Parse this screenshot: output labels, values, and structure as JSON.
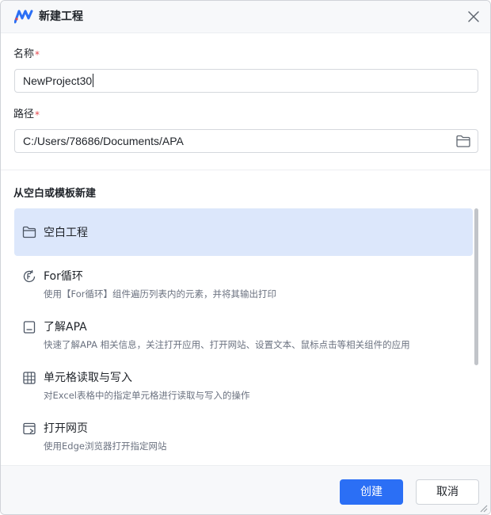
{
  "dialog": {
    "title": "新建工程",
    "logo_icon": "apa-logo-icon",
    "close_icon": "close-icon"
  },
  "form": {
    "name_label": "名称",
    "name_required": "*",
    "name_value": "NewProject30",
    "path_label": "路径",
    "path_required": "*",
    "path_value": "C:/Users/78686/Documents/APA",
    "path_browse_icon": "folder-icon"
  },
  "templates": {
    "section_title": "从空白或模板新建",
    "items": [
      {
        "icon": "folder-outline-icon",
        "title": "空白工程",
        "desc": "",
        "selected": true
      },
      {
        "icon": "for-loop-icon",
        "title": "For循环",
        "desc": "使用【For循环】组件遍历列表内的元素，并将其输出打印",
        "selected": false
      },
      {
        "icon": "document-icon",
        "title": "了解APA",
        "desc": "快速了解APA 相关信息，关注打开应用、打开网站、设置文本、鼠标点击等相关组件的应用",
        "selected": false
      },
      {
        "icon": "table-icon",
        "title": "单元格读取与写入",
        "desc": "对Excel表格中的指定单元格进行读取与写入的操作",
        "selected": false
      },
      {
        "icon": "browser-icon",
        "title": "打开网页",
        "desc": "使用Edge浏览器打开指定网站",
        "selected": false
      }
    ]
  },
  "footer": {
    "create_label": "创建",
    "cancel_label": "取消"
  },
  "colors": {
    "accent": "#2b6ff5",
    "selected_bg": "#dce7fb",
    "required": "#e5484d"
  }
}
